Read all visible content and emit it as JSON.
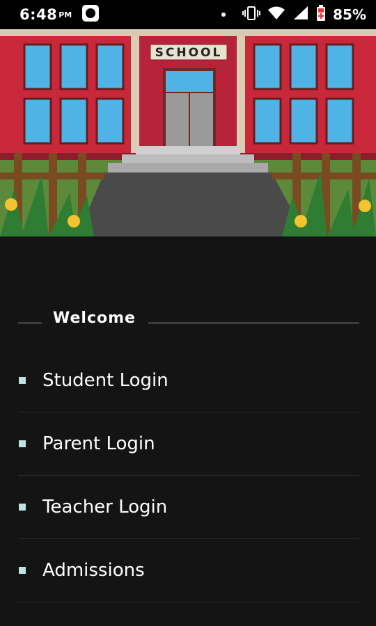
{
  "status_bar": {
    "time": "6:48",
    "ampm": "PM",
    "battery_percent": "85%",
    "icons": [
      "app-notification-icon",
      "dot-icon",
      "vibrate-icon",
      "wifi-icon",
      "signal-icon",
      "battery-icon"
    ]
  },
  "banner": {
    "sign_text": "SCHOOL"
  },
  "welcome": {
    "label": "Welcome"
  },
  "menu": {
    "items": [
      {
        "label": "Student Login"
      },
      {
        "label": "Parent Login"
      },
      {
        "label": "Teacher Login"
      },
      {
        "label": "Admissions"
      }
    ]
  },
  "colors": {
    "background": "#141414",
    "bullet": "#bfe3e3",
    "divider": "#2a2a2a",
    "building_red": "#c8283a"
  }
}
